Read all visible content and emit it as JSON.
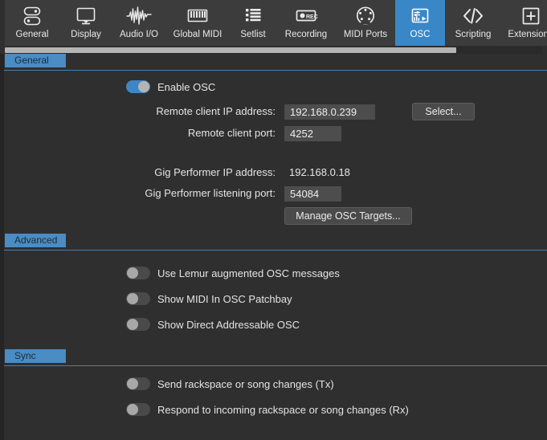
{
  "toolbar": {
    "tabs": [
      {
        "label": "General",
        "icon": "servers-icon",
        "selected": false
      },
      {
        "label": "Display",
        "icon": "monitor-icon",
        "selected": false
      },
      {
        "label": "Audio I/O",
        "icon": "waveform-icon",
        "selected": false
      },
      {
        "label": "Global MIDI",
        "icon": "piano-keys-icon",
        "selected": false
      },
      {
        "label": "Setlist",
        "icon": "list-icon",
        "selected": false
      },
      {
        "label": "Recording",
        "icon": "rec-button-icon",
        "selected": false
      },
      {
        "label": "MIDI Ports",
        "icon": "midi-din-icon",
        "selected": false
      },
      {
        "label": "OSC",
        "icon": "osc-panel-icon",
        "selected": true
      },
      {
        "label": "Scripting",
        "icon": "code-brackets-icon",
        "selected": false
      },
      {
        "label": "Extensions",
        "icon": "plus-box-icon",
        "selected": false
      }
    ]
  },
  "scrollbar": {
    "name": "horizontal-scrollbar"
  },
  "sections": {
    "general": {
      "title": "General",
      "enable_osc": {
        "label": "Enable OSC",
        "state": "on"
      },
      "remote_ip": {
        "label": "Remote client IP address:",
        "value": "192.168.0.239",
        "placeholder": ""
      },
      "remote_port": {
        "label": "Remote client port:",
        "value": "4252",
        "placeholder": ""
      },
      "select_button": "Select...",
      "gp_ip": {
        "label": "Gig Performer IP address:",
        "value": "192.168.0.18"
      },
      "gp_port": {
        "label": "Gig Performer listening port:",
        "value": "54084",
        "placeholder": ""
      },
      "manage_button": "Manage OSC Targets..."
    },
    "advanced": {
      "title": "Advanced",
      "toggles": [
        {
          "label": "Use Lemur augmented OSC messages",
          "state": "off"
        },
        {
          "label": "Show MIDI In OSC Patchbay",
          "state": "off"
        },
        {
          "label": "Show Direct Addressable OSC",
          "state": "off"
        }
      ]
    },
    "sync": {
      "title": "Sync",
      "toggles": [
        {
          "label": "Send rackspace or song changes (Tx)",
          "state": "off"
        },
        {
          "label": "Respond to incoming rackspace or song changes (Rx)",
          "state": "off"
        }
      ]
    }
  },
  "colors": {
    "accent": "#4a8cc4",
    "toolbar_bg": "#3c3c3c",
    "body_bg": "#2f2f2f",
    "field_bg": "#4d4d4d",
    "toggle_on": "#3f86c4",
    "toggle_off": "#4a4a4a"
  }
}
